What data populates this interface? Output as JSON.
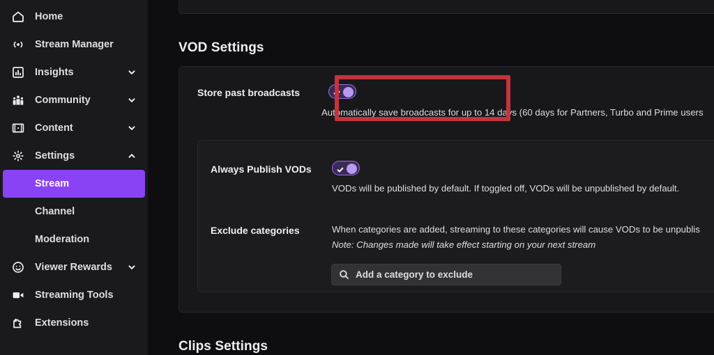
{
  "sidebar": {
    "items": [
      {
        "label": "Home",
        "icon": "home-icon",
        "chevron": "none"
      },
      {
        "label": "Stream Manager",
        "icon": "broadcast-icon",
        "chevron": "none"
      },
      {
        "label": "Insights",
        "icon": "chart-icon",
        "chevron": "down"
      },
      {
        "label": "Community",
        "icon": "people-icon",
        "chevron": "down"
      },
      {
        "label": "Content",
        "icon": "video-frame-icon",
        "chevron": "down"
      },
      {
        "label": "Settings",
        "icon": "gear-icon",
        "chevron": "up"
      }
    ],
    "sub_items": [
      {
        "label": "Stream",
        "active": true
      },
      {
        "label": "Channel",
        "active": false
      },
      {
        "label": "Moderation",
        "active": false
      }
    ],
    "items_after": [
      {
        "label": "Viewer Rewards",
        "icon": "smiley-icon",
        "chevron": "down"
      },
      {
        "label": "Streaming Tools",
        "icon": "camcorder-icon",
        "chevron": "none"
      },
      {
        "label": "Extensions",
        "icon": "puzzle-icon",
        "chevron": "none"
      }
    ],
    "active_color": "#8a42f5"
  },
  "main": {
    "vod_section_title": "VOD Settings",
    "clips_section_title": "Clips Settings",
    "store_past_broadcasts": {
      "label": "Store past broadcasts",
      "toggle_state": "on",
      "description": "Automatically save broadcasts for up to 14 days (60 days for Partners, Turbo and Prime users"
    },
    "always_publish_vods": {
      "label": "Always Publish VODs",
      "toggle_state": "on",
      "description": "VODs will be published by default. If toggled off, VODs will be unpublished by default."
    },
    "exclude_categories": {
      "label": "Exclude categories",
      "description": "When categories are added, streaming to these categories will cause VODs to be unpublis",
      "note": "Note: Changes made will take effect starting on your next stream",
      "search_placeholder": "Add a category to exclude",
      "search_value": ""
    }
  },
  "annotation": {
    "highlight_color": "#c4343c",
    "target": "store-past-broadcasts-row"
  }
}
